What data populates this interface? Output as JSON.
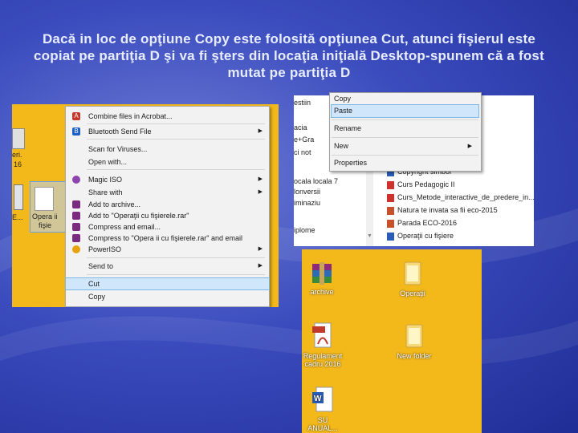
{
  "title": "Dacă in loc de opţiune Copy este folosită opţiunea Cut, atunci fişierul este copiat pe partiţia D şi va fi şters din locaţia iniţială Desktop-spunem că a fost mutat pe partiţia D",
  "panel1": {
    "desktop_labels": [
      "eri.",
      "16",
      "E...",
      "Opera ii",
      "fişie"
    ],
    "context_menu": [
      {
        "label": "Combine files in Acrobat...",
        "icon": "acrobat-icon",
        "submenu": false
      },
      {
        "label": "Bluetooth Send File",
        "icon": "bluetooth-icon",
        "submenu": true
      },
      {
        "label": "Scan for Viruses...",
        "icon": "",
        "submenu": false
      },
      {
        "label": "Open with...",
        "icon": "",
        "submenu": false
      },
      {
        "label": "Magic ISO",
        "icon": "disc-icon",
        "submenu": true
      },
      {
        "label": "Share with",
        "icon": "",
        "submenu": true
      },
      {
        "label": "Add to archive...",
        "icon": "archive-icon",
        "submenu": false
      },
      {
        "label": "Add to \"Operaţii cu fişierele.rar\"",
        "icon": "archive-icon",
        "submenu": false
      },
      {
        "label": "Compress and email...",
        "icon": "archive-icon",
        "submenu": false
      },
      {
        "label": "Compress to \"Opera ii cu fişierele.rar\" and email",
        "icon": "archive-icon",
        "submenu": false
      },
      {
        "label": "PowerISO",
        "icon": "poweriso-icon",
        "submenu": true
      },
      {
        "label": "Send to",
        "icon": "",
        "submenu": true
      },
      {
        "label": "Cut",
        "icon": "",
        "submenu": false,
        "highlighted": true
      },
      {
        "label": "Copy",
        "icon": "",
        "submenu": false
      }
    ]
  },
  "panel2": {
    "left_items": [
      "estiin",
      "acia",
      "e+Gra",
      "ci not",
      "ocala locala 7",
      "lonversii",
      "iminaziu",
      "iplome"
    ],
    "files": [
      {
        "name": "Copyright simbol",
        "type": "word"
      },
      {
        "name": "Curs Pedagogic II",
        "type": "pdf"
      },
      {
        "name": "Curs_Metode_interactive_de_predere_in...",
        "type": "pdf"
      },
      {
        "name": "Natura te invata sa fii eco-2015",
        "type": "ppt"
      },
      {
        "name": "Parada ECO-2016",
        "type": "ppt"
      },
      {
        "name": "Operaţii cu fişiere",
        "type": "word"
      }
    ],
    "menu": [
      {
        "label": "Copy",
        "submenu": false
      },
      {
        "label": "Paste",
        "submenu": false,
        "highlighted": true
      },
      {
        "label": "Rename",
        "submenu": false
      },
      {
        "label": "New",
        "submenu": true
      },
      {
        "label": "Properties",
        "submenu": false
      }
    ]
  },
  "panel3": {
    "icons": [
      {
        "label": "archive",
        "type": "winrar"
      },
      {
        "label": "Operaţii",
        "type": "folder"
      },
      {
        "label": "Regulament cadru 2016",
        "type": "pdf"
      },
      {
        "label": "New folder",
        "type": "folder"
      },
      {
        "label": "SU ANUAL...",
        "type": "word"
      }
    ]
  }
}
